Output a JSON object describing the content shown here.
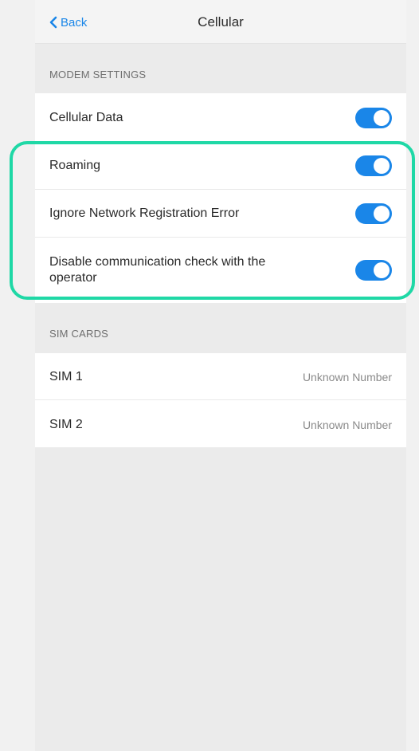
{
  "navbar": {
    "back_label": "Back",
    "title": "Cellular"
  },
  "modem_section": {
    "header": "MODEM SETTINGS",
    "items": [
      {
        "label": "Cellular Data",
        "enabled": true
      },
      {
        "label": "Roaming",
        "enabled": true
      },
      {
        "label": "Ignore Network Registration Error",
        "enabled": true
      },
      {
        "label": "Disable communication check with the operator",
        "enabled": true
      }
    ]
  },
  "sim_section": {
    "header": "SIM CARDS",
    "items": [
      {
        "label": "SIM 1",
        "value": "Unknown Number"
      },
      {
        "label": "SIM 2",
        "value": "Unknown Number"
      }
    ]
  },
  "colors": {
    "accent": "#1a86e8",
    "highlight": "#1fd8a6"
  },
  "icons": {
    "back": "chevron-left-icon"
  }
}
